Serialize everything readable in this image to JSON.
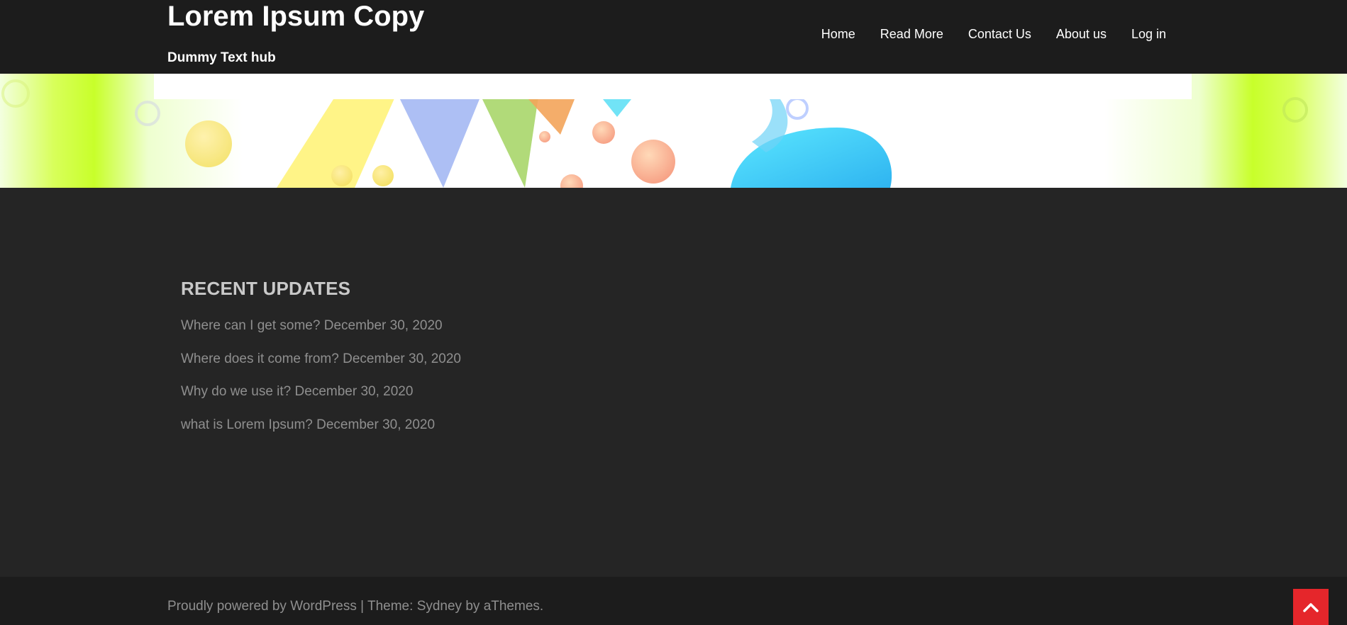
{
  "header": {
    "site_title": "Lorem Ipsum Copy",
    "tagline": "Dummy Text hub",
    "nav": [
      {
        "label": "Home"
      },
      {
        "label": "Read More"
      },
      {
        "label": "Contact Us"
      },
      {
        "label": "About us"
      },
      {
        "label": "Log in"
      }
    ]
  },
  "recent_updates": {
    "heading": "RECENT UPDATES",
    "items": [
      {
        "title": "Where can I get some?",
        "date": "December 30, 2020"
      },
      {
        "title": "Where does it come from?",
        "date": "December 30, 2020"
      },
      {
        "title": "Why do we use it?",
        "date": "December 30, 2020"
      },
      {
        "title": "what is Lorem Ipsum?",
        "date": "December 30, 2020"
      }
    ]
  },
  "footer": {
    "prefix": "Proudly powered by ",
    "wordpress_link": "WordPress",
    "separator": " | Theme: ",
    "theme_link": "Sydney",
    "by_text": " by ",
    "athemes_link": "aThemes",
    "suffix": "."
  },
  "go_top": {
    "icon": "chevron-up-icon"
  },
  "colors": {
    "header_bg": "#1c1c1c",
    "body_bg": "#252525",
    "accent": "#e5262b",
    "muted_text": "#8f8f8f",
    "heading_text": "#c9c9c9"
  }
}
